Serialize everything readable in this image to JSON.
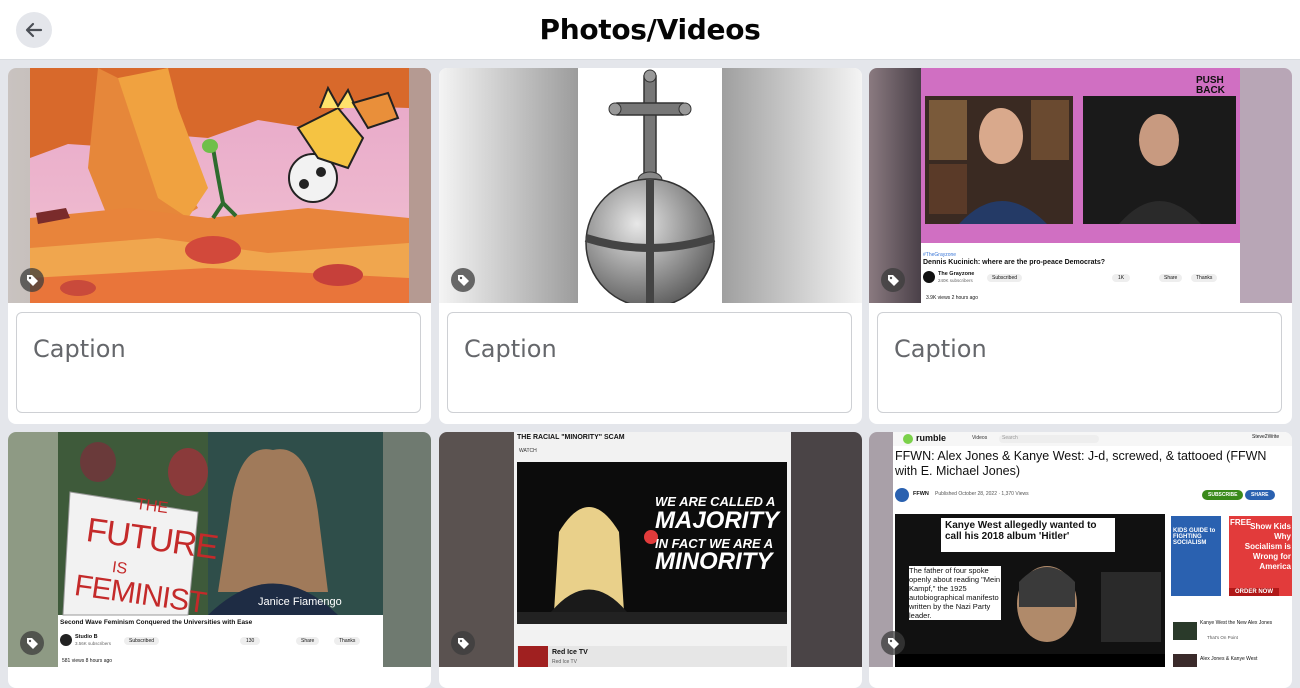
{
  "header": {
    "title": "Photos/Videos",
    "back_icon": "arrow-left-icon"
  },
  "colors": {
    "background": "#e4e6eb",
    "card": "#ffffff",
    "caption_text": "#65676b"
  },
  "cards": [
    {
      "caption_placeholder": "Caption",
      "media_kind": "comic panel illustration",
      "tag_icon": "tag-icon"
    },
    {
      "caption_placeholder": "Caption",
      "media_kind": "engraving of orb with cross",
      "tag_icon": "tag-icon"
    },
    {
      "caption_placeholder": "Caption",
      "media_kind": "video call screenshot",
      "tag_icon": "tag-icon",
      "overlay": {
        "logo": "PUSH BACK",
        "hashtag": "#TheGrayzone",
        "video_title": "Dennis Kucinich: where are the pro-peace Democrats?",
        "channel": "The Grayzone",
        "subscribers": "240K subscribers",
        "subscribed": "Subscribed",
        "likes": "1K",
        "share": "Share",
        "thanks": "Thanks",
        "views": "3.9K views  2 hours ago"
      }
    },
    {
      "tag_icon": "tag-icon",
      "overlay": {
        "sign_line1": "THE",
        "sign_line2": "FUTURE",
        "sign_line3": "IS",
        "sign_line4": "FEMINIST",
        "presenter": "Janice Fiamengo",
        "video_title": "Second Wave Feminism Conquered the Universities with Ease",
        "channel": "Studio B",
        "subscribers": "3.56K subscribers",
        "subscribed": "Subscribed",
        "likes": "130",
        "share": "Share",
        "thanks": "Thanks",
        "views": "581 views  8 hours ago"
      }
    },
    {
      "tag_icon": "tag-icon",
      "overlay": {
        "page_title": "THE RACIAL \"MINORITY\" SCAM",
        "watch": "WATCH",
        "line1": "WE ARE CALLED A",
        "line2": "MAJORITY",
        "line3": "IN FACT WE ARE A",
        "line4": "MINORITY",
        "channel": "Red Ice TV",
        "channel_sub": "Red Ice TV"
      }
    },
    {
      "tag_icon": "tag-icon",
      "overlay": {
        "site": "rumble",
        "videos_menu": "Videos",
        "search": "Search",
        "user": "Steve2Write",
        "headline": "FFWN: Alex Jones & Kanye West: J-d, screwed, & tattooed (FFWN with E. Michael Jones)",
        "channel": "FFWN",
        "published": "Published October 28, 2022  ·  1,370 Views",
        "subscribe": "SUBSCRIBE",
        "share": "SHARE",
        "article_title": "Kanye West allegedly wanted to call his 2018 album 'Hitler'",
        "article_body": "The father of four spoke openly about reading \"Mein Kampf,\" the 1925 autobiographical manifesto written by the Nazi Party leader.",
        "ad_text": "Show Kids Why Socialism is Wrong for America",
        "ad_badge": "FREE",
        "ad_button": "ORDER NOW",
        "ad_book": "KIDS GUIDE to FIGHTING SOCIALISM",
        "side1": "Kanye West the New Alex Jones",
        "side1_sub": "That's On Point",
        "side2": "Alex Jones & Kanye West"
      }
    }
  ]
}
